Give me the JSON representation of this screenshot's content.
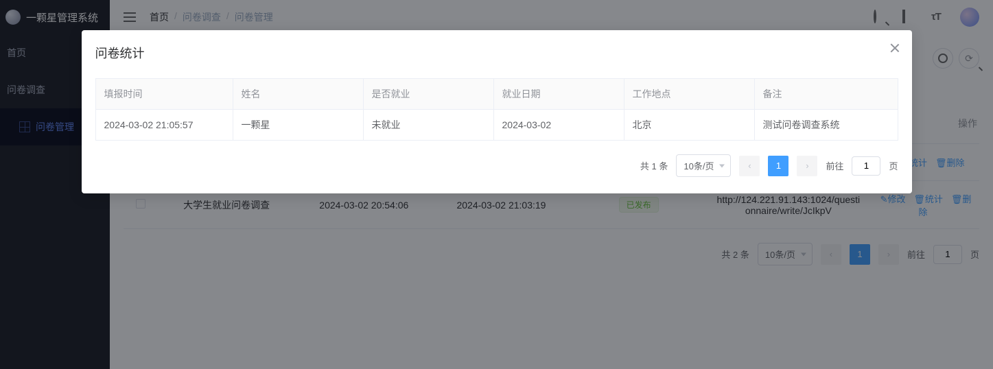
{
  "app": {
    "name": "一颗星管理系统"
  },
  "sidebar": {
    "items": [
      {
        "label": "首页"
      },
      {
        "label": "问卷调查"
      },
      {
        "label": "问卷管理"
      }
    ]
  },
  "breadcrumb": {
    "items": [
      "首页",
      "问卷调查",
      "问卷管理"
    ],
    "sep": "/"
  },
  "bgTable": {
    "headers": {
      "op": "操作"
    },
    "rows": [
      {
        "title": "大学生就业问卷调查",
        "created": "2024-03-02 20:54:06",
        "updated": "2024-03-02 21:03:19",
        "status": "已发布",
        "url": "http://124.221.91.143:1024/questionnaire/write/JcIkpV",
        "actions": {
          "edit": "修改",
          "stats": "统计",
          "delete": "删除"
        }
      }
    ],
    "visibleActionsRow0": {
      "stats": "统计",
      "delete": "删除"
    }
  },
  "bgPager": {
    "total": "共 2 条",
    "size": "10条/页",
    "page": "1",
    "jump_prefix": "前往",
    "jump_input": "1",
    "jump_suffix": "页"
  },
  "modal": {
    "title": "问卷统计",
    "headers": {
      "time": "填报时间",
      "name": "姓名",
      "employed": "是否就业",
      "date": "就业日期",
      "place": "工作地点",
      "note": "备注"
    },
    "rows": [
      {
        "time": "2024-03-02 21:05:57",
        "name": "一颗星",
        "employed": "未就业",
        "date": "2024-03-02",
        "place": "北京",
        "note": "测试问卷调查系统"
      }
    ],
    "pager": {
      "total": "共 1 条",
      "size": "10条/页",
      "page": "1",
      "jump_prefix": "前往",
      "jump_input": "1",
      "jump_suffix": "页"
    }
  }
}
